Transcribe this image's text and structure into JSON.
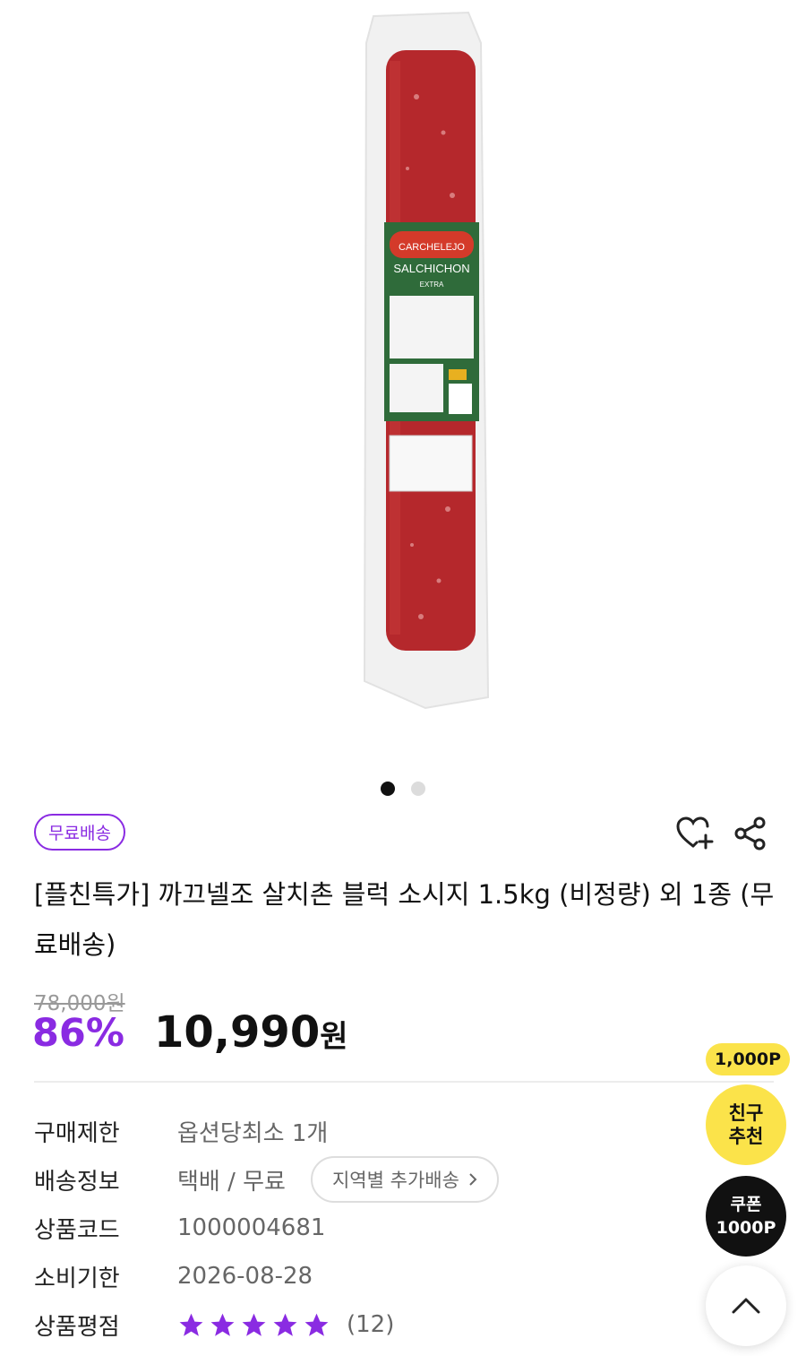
{
  "gallery": {
    "brand_label": "CARCHELEJO",
    "product_label": "SALCHICHON",
    "sub_label": "EXTRA",
    "page_count": 2,
    "active_index": 0
  },
  "badge": {
    "label": "무료배송"
  },
  "actions": {
    "wishlist_icon": "heart-plus-icon",
    "share_icon": "share-icon"
  },
  "product": {
    "title": "[플친특가] 까끄넬조 살치촌 블럭 소시지 1.5kg (비정량) 외 1종 (무료배송)",
    "original_price": "78,000원",
    "discount": "86%",
    "price": "10,990",
    "price_unit": "원"
  },
  "info": {
    "purchase_limit": {
      "label": "구매제한",
      "value": "옵션당최소 1개"
    },
    "delivery": {
      "label": "배송정보",
      "value": "택배 / 무료",
      "region_button": "지역별 추가배송"
    },
    "product_code": {
      "label": "상품코드",
      "value": "1000004681"
    },
    "expiry": {
      "label": "소비기한",
      "value": "2026-08-28"
    },
    "rating": {
      "label": "상품평점",
      "stars": 5,
      "count": "(12)"
    }
  },
  "floating": {
    "points": "1,000P",
    "friend_line1": "친구",
    "friend_line2": "추천",
    "coupon_line1": "쿠폰",
    "coupon_line2": "1000P"
  },
  "colors": {
    "accent": "#8a2be2",
    "yellow": "#fbe34a",
    "star": "#8a2be2"
  }
}
